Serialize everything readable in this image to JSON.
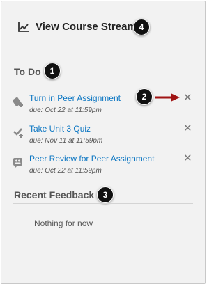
{
  "header": {
    "stream_label": "View Course Stream",
    "stream_icon": "line-chart-icon"
  },
  "todo": {
    "title": "To Do",
    "items": [
      {
        "title": "Turn in Peer Assignment",
        "due": "due: Oct 22 at 11:59pm",
        "icon": "assignment-icon"
      },
      {
        "title": "Take Unit 3 Quiz",
        "due": "due: Nov 11 at 11:59pm",
        "icon": "quiz-icon"
      },
      {
        "title": "Peer Review for Peer Assignment",
        "due": "due: Oct 22 at 11:59pm",
        "icon": "peer-review-icon"
      }
    ]
  },
  "feedback": {
    "title": "Recent Feedback",
    "empty_message": "Nothing for now"
  },
  "callouts": [
    "1",
    "2",
    "3",
    "4"
  ],
  "colors": {
    "link": "#0a75c2",
    "callout": "#111111",
    "arrow": "#a01414",
    "panel": "#f2f2f2"
  }
}
